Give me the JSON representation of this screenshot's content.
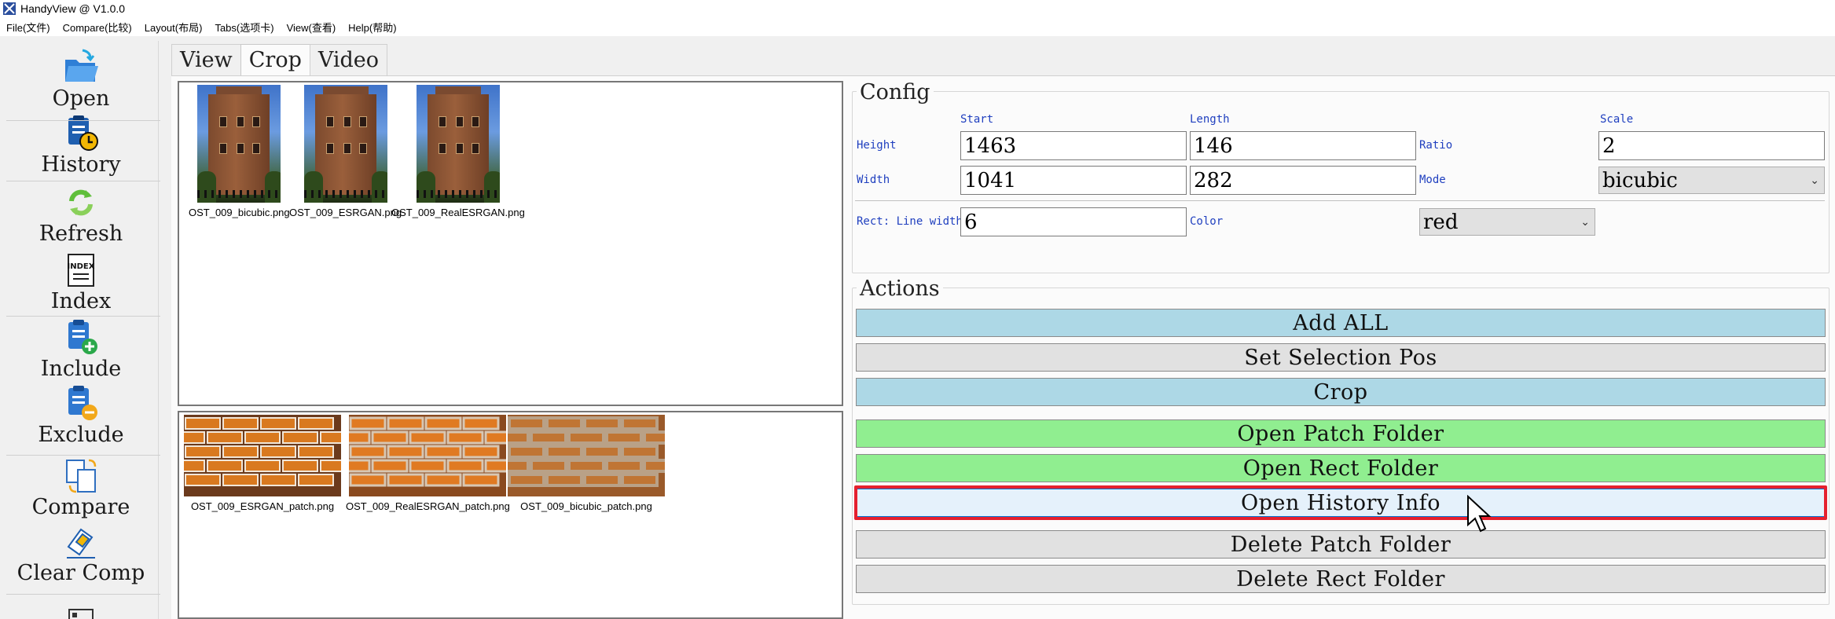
{
  "window": {
    "title": "HandyView @ V1.0.0"
  },
  "menu": [
    "File(文件)",
    "Compare(比较)",
    "Layout(布局)",
    "Tabs(选项卡)",
    "View(查看)",
    "Help(帮助)"
  ],
  "sidebar": [
    {
      "label": "Open",
      "icon": "folder-open-icon"
    },
    {
      "label": "History",
      "icon": "history-clipboard-icon"
    },
    {
      "label": "Refresh",
      "icon": "refresh-icon"
    },
    {
      "label": "Index",
      "icon": "index-icon"
    },
    {
      "label": "Include",
      "icon": "include-clipboard-icon"
    },
    {
      "label": "Exclude",
      "icon": "exclude-clipboard-icon"
    },
    {
      "label": "Compare",
      "icon": "compare-icon"
    },
    {
      "label": "Clear Comp",
      "icon": "eraser-icon"
    }
  ],
  "tabs": [
    {
      "label": "View",
      "active": false
    },
    {
      "label": "Crop",
      "active": true
    },
    {
      "label": "Video",
      "active": false
    }
  ],
  "images": [
    {
      "filename": "OST_009_bicubic.png"
    },
    {
      "filename": "OST_009_ESRGAN.png"
    },
    {
      "filename": "OST_009_RealESRGAN.png"
    }
  ],
  "patches": [
    {
      "filename": "OST_009_ESRGAN_patch.png"
    },
    {
      "filename": "OST_009_RealESRGAN_patch.png"
    },
    {
      "filename": "OST_009_bicubic_patch.png"
    }
  ],
  "config": {
    "title": "Config",
    "headers": {
      "start": "Start",
      "length": "Length",
      "scale": "Scale"
    },
    "height_label": "Height",
    "width_label": "Width",
    "ratio_label": "Ratio",
    "mode_label": "Mode",
    "height_start": "1463",
    "height_length": "146",
    "width_start": "1041",
    "width_length": "282",
    "scale": "2",
    "mode": "bicubic",
    "rect_line_width_label": "Rect: Line width",
    "rect_line_width": "6",
    "color_label": "Color",
    "color": "red"
  },
  "actions": {
    "title": "Actions",
    "buttons": [
      {
        "label": "Add ALL",
        "style": "blue"
      },
      {
        "label": "Set Selection Pos",
        "style": "gray"
      },
      {
        "label": "Crop",
        "style": "blue"
      },
      {
        "label": "Open Patch Folder",
        "style": "green"
      },
      {
        "label": "Open Rect Folder",
        "style": "green"
      },
      {
        "label": "Open History Info",
        "style": "hover"
      },
      {
        "label": "Delete Patch Folder",
        "style": "gray"
      },
      {
        "label": "Delete Rect Folder",
        "style": "gray"
      }
    ]
  },
  "colors": {
    "blue_button": "#add8e6",
    "green_button": "#90ee90",
    "gray_button": "#e1e1e1",
    "highlight": "#e5202e",
    "label_blue": "#1f3fbf"
  }
}
